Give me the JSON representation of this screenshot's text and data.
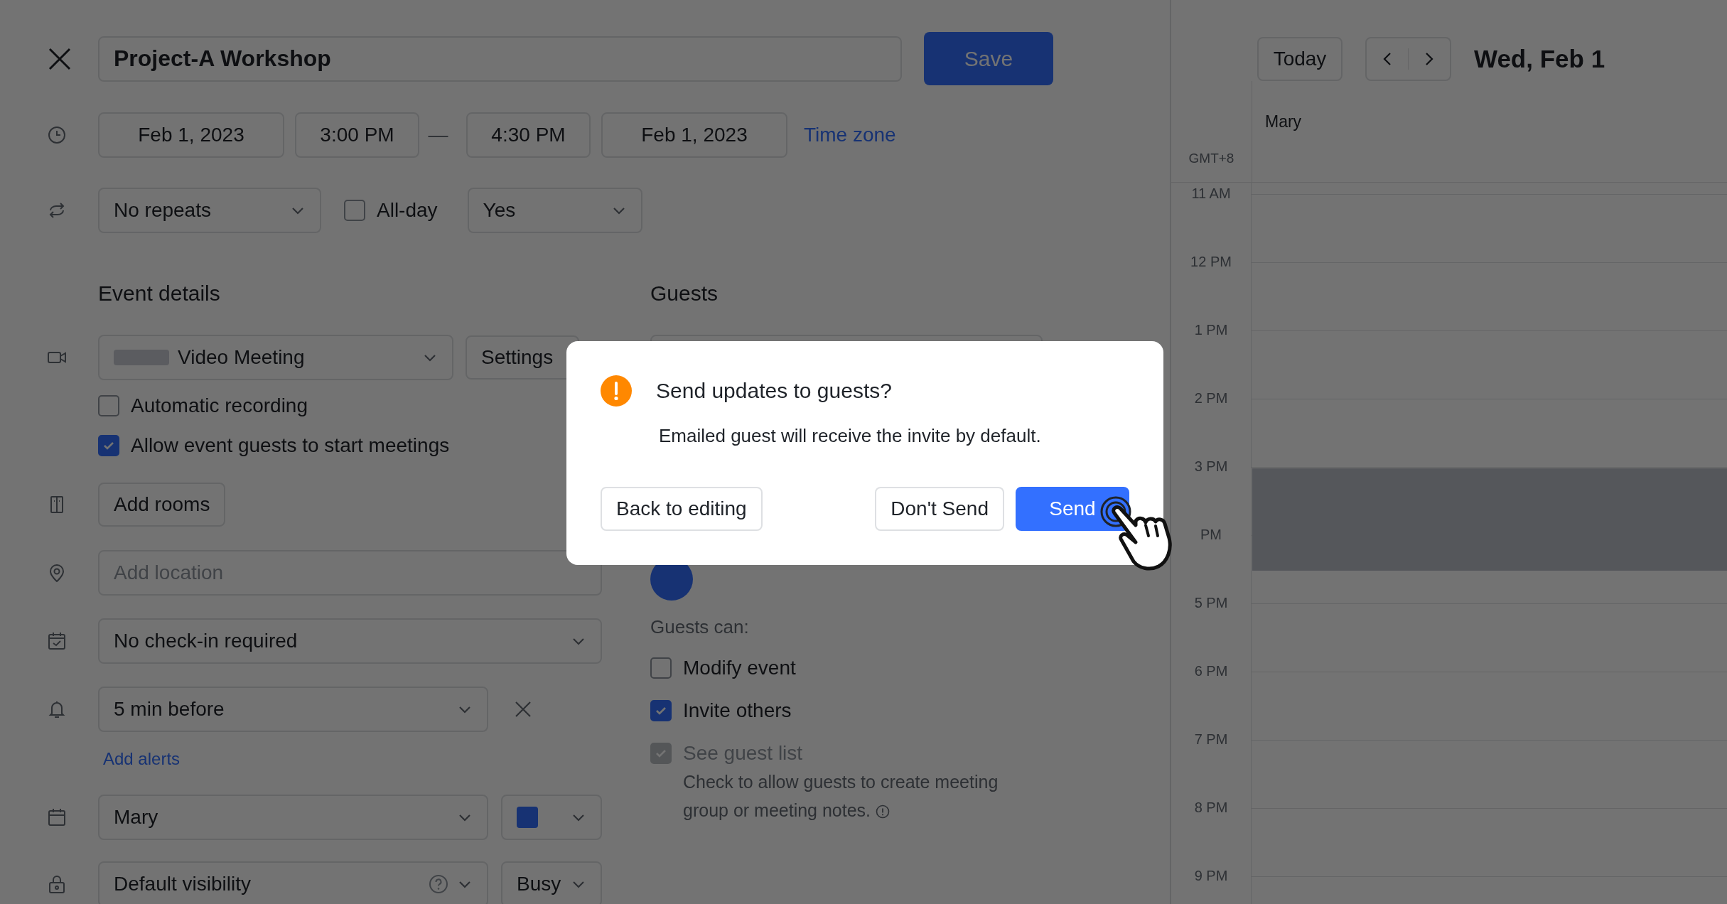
{
  "event_title": "Project-A Workshop",
  "save_button": "Save",
  "time": {
    "start_date": "Feb 1, 2023",
    "start_time": "3:00 PM",
    "separator": "—",
    "end_time": "4:30 PM",
    "end_date": "Feb 1, 2023",
    "timezone_link": "Time zone"
  },
  "repeat": {
    "value": "No repeats"
  },
  "all_day": {
    "label": "All-day",
    "checked": false
  },
  "show_as": {
    "value": "Yes"
  },
  "event_details": {
    "heading": "Event details",
    "meeting": {
      "value": "Video Meeting",
      "settings_button": "Settings"
    },
    "options": [
      {
        "label": "Automatic recording",
        "checked": false
      },
      {
        "label": "Allow event guests to start meetings",
        "checked": true
      }
    ],
    "add_rooms_button": "Add rooms",
    "location": {
      "placeholder": "Add location"
    },
    "check_in": {
      "value": "No check-in required"
    },
    "alert": {
      "value": "5 min before"
    },
    "add_alerts_link": "Add alerts",
    "calendar": {
      "value": "Mary"
    },
    "visibility": {
      "value": "Default visibility"
    },
    "availability": {
      "value": "Busy"
    }
  },
  "guests": {
    "heading": "Guests",
    "permissions_heading": "Guests can:",
    "permissions": [
      {
        "label": "Modify event",
        "checked": false,
        "disabled": false
      },
      {
        "label": "Invite others",
        "checked": true,
        "disabled": false
      },
      {
        "label": "See guest list",
        "checked": true,
        "disabled": true
      }
    ],
    "note": "Check to allow guests to create meeting group or meeting notes."
  },
  "calendar_view": {
    "today_button": "Today",
    "date_title": "Wed, Feb 1",
    "column": "Mary",
    "timezone": "GMT+8",
    "hours": [
      "11 AM",
      "12 PM",
      "1 PM",
      "2 PM",
      "3 PM",
      "PM",
      "5 PM",
      "6 PM",
      "7 PM",
      "8 PM",
      "9 PM"
    ]
  },
  "dialog": {
    "title": "Send updates to guests?",
    "message": "Emailed guest will receive the invite by default.",
    "buttons": [
      {
        "label": "Back to editing",
        "kind": "secondary"
      },
      {
        "label": "Don't Send",
        "kind": "secondary"
      },
      {
        "label": "Send",
        "kind": "primary"
      }
    ]
  }
}
